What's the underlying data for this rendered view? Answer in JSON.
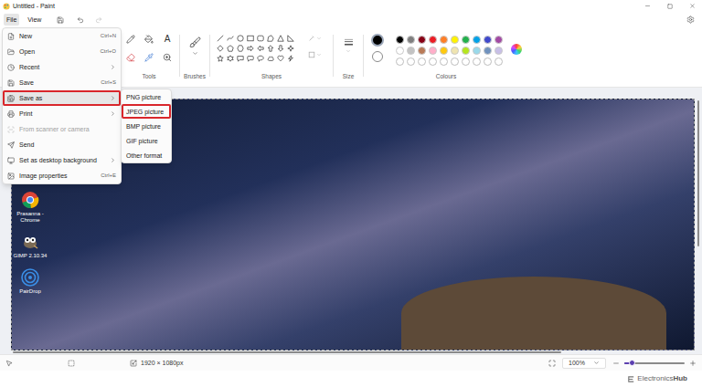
{
  "window": {
    "title": "Untitled - Paint"
  },
  "menu_bar": [
    {
      "label": "File",
      "selected": true
    },
    {
      "label": "View",
      "selected": false
    }
  ],
  "ribbon": {
    "tools_label": "Tools",
    "text_tool_glyph": "A",
    "brushes_label": "Brushes",
    "shapes_label": "Shapes",
    "size_label": "Size",
    "colours_label": "Colours",
    "primary_color": "#000000",
    "secondary_color": "#ffffff",
    "palette": [
      {
        "kind": "swatch",
        "color": "#000000"
      },
      {
        "kind": "swatch",
        "color": "#7f7f7f"
      },
      {
        "kind": "swatch",
        "color": "#880015"
      },
      {
        "kind": "swatch",
        "color": "#ed1c24"
      },
      {
        "kind": "swatch",
        "color": "#ff7f27"
      },
      {
        "kind": "swatch",
        "color": "#fff200"
      },
      {
        "kind": "swatch",
        "color": "#22b14c"
      },
      {
        "kind": "swatch",
        "color": "#00a2e8"
      },
      {
        "kind": "swatch",
        "color": "#3f48cc"
      },
      {
        "kind": "swatch",
        "color": "#a349a4"
      },
      {
        "kind": "swatch",
        "color": "#ffffff"
      },
      {
        "kind": "swatch",
        "color": "#c3c3c3"
      },
      {
        "kind": "swatch",
        "color": "#b97a57"
      },
      {
        "kind": "swatch",
        "color": "#ffaec9"
      },
      {
        "kind": "swatch",
        "color": "#ffc90e"
      },
      {
        "kind": "swatch",
        "color": "#efe4b0"
      },
      {
        "kind": "swatch",
        "color": "#b5e61d"
      },
      {
        "kind": "swatch",
        "color": "#99d9ea"
      },
      {
        "kind": "swatch",
        "color": "#7092be"
      },
      {
        "kind": "swatch",
        "color": "#c8bfe7"
      },
      {
        "kind": "empty"
      },
      {
        "kind": "empty"
      },
      {
        "kind": "empty"
      },
      {
        "kind": "empty"
      },
      {
        "kind": "empty"
      },
      {
        "kind": "empty"
      },
      {
        "kind": "empty"
      },
      {
        "kind": "empty"
      },
      {
        "kind": "empty"
      },
      {
        "kind": "empty"
      }
    ]
  },
  "file_menu": {
    "items": [
      {
        "label": "New",
        "shortcut": "Ctrl+N",
        "submenu": false,
        "disabled": false,
        "hovered": false,
        "highlighted": false
      },
      {
        "label": "Open",
        "shortcut": "Ctrl+O",
        "submenu": false,
        "disabled": false,
        "hovered": false,
        "highlighted": false
      },
      {
        "label": "Recent",
        "submenu": true,
        "disabled": false,
        "hovered": false,
        "highlighted": false
      },
      {
        "label": "Save",
        "shortcut": "Ctrl+S",
        "submenu": false,
        "disabled": false,
        "hovered": false,
        "highlighted": false
      },
      {
        "label": "Save as",
        "submenu": true,
        "disabled": false,
        "hovered": true,
        "highlighted": true
      },
      {
        "label": "Print",
        "submenu": true,
        "disabled": false,
        "hovered": false,
        "highlighted": false
      },
      {
        "label": "From scanner or camera",
        "submenu": false,
        "disabled": true,
        "hovered": false,
        "highlighted": false
      },
      {
        "label": "Send",
        "submenu": false,
        "disabled": false,
        "hovered": false,
        "highlighted": false
      },
      {
        "label": "Set as desktop background",
        "submenu": true,
        "disabled": false,
        "hovered": false,
        "highlighted": false
      },
      {
        "label": "Image properties",
        "shortcut": "Ctrl+E",
        "submenu": false,
        "disabled": false,
        "hovered": false,
        "highlighted": false
      }
    ]
  },
  "save_as_submenu": {
    "items": [
      {
        "label": "PNG picture",
        "highlighted": false
      },
      {
        "label": "JPEG picture",
        "highlighted": true
      },
      {
        "label": "BMP picture",
        "highlighted": false
      },
      {
        "label": "GIF picture",
        "highlighted": false
      },
      {
        "label": "Other format",
        "highlighted": false
      }
    ]
  },
  "canvas": {
    "desktop_icons": [
      {
        "label": "Prasanna - Chrome",
        "kind": "chrome"
      },
      {
        "label": "GIMP 2.10.34",
        "kind": "gimp"
      },
      {
        "label": "PairDrop",
        "kind": "pairdrop"
      }
    ]
  },
  "status_bar": {
    "canvas_size": "1920 × 1080px",
    "zoom": "100%",
    "zoom_level": 0.12
  },
  "watermark": {
    "brand": "Electronics",
    "suffix": "Hub"
  }
}
